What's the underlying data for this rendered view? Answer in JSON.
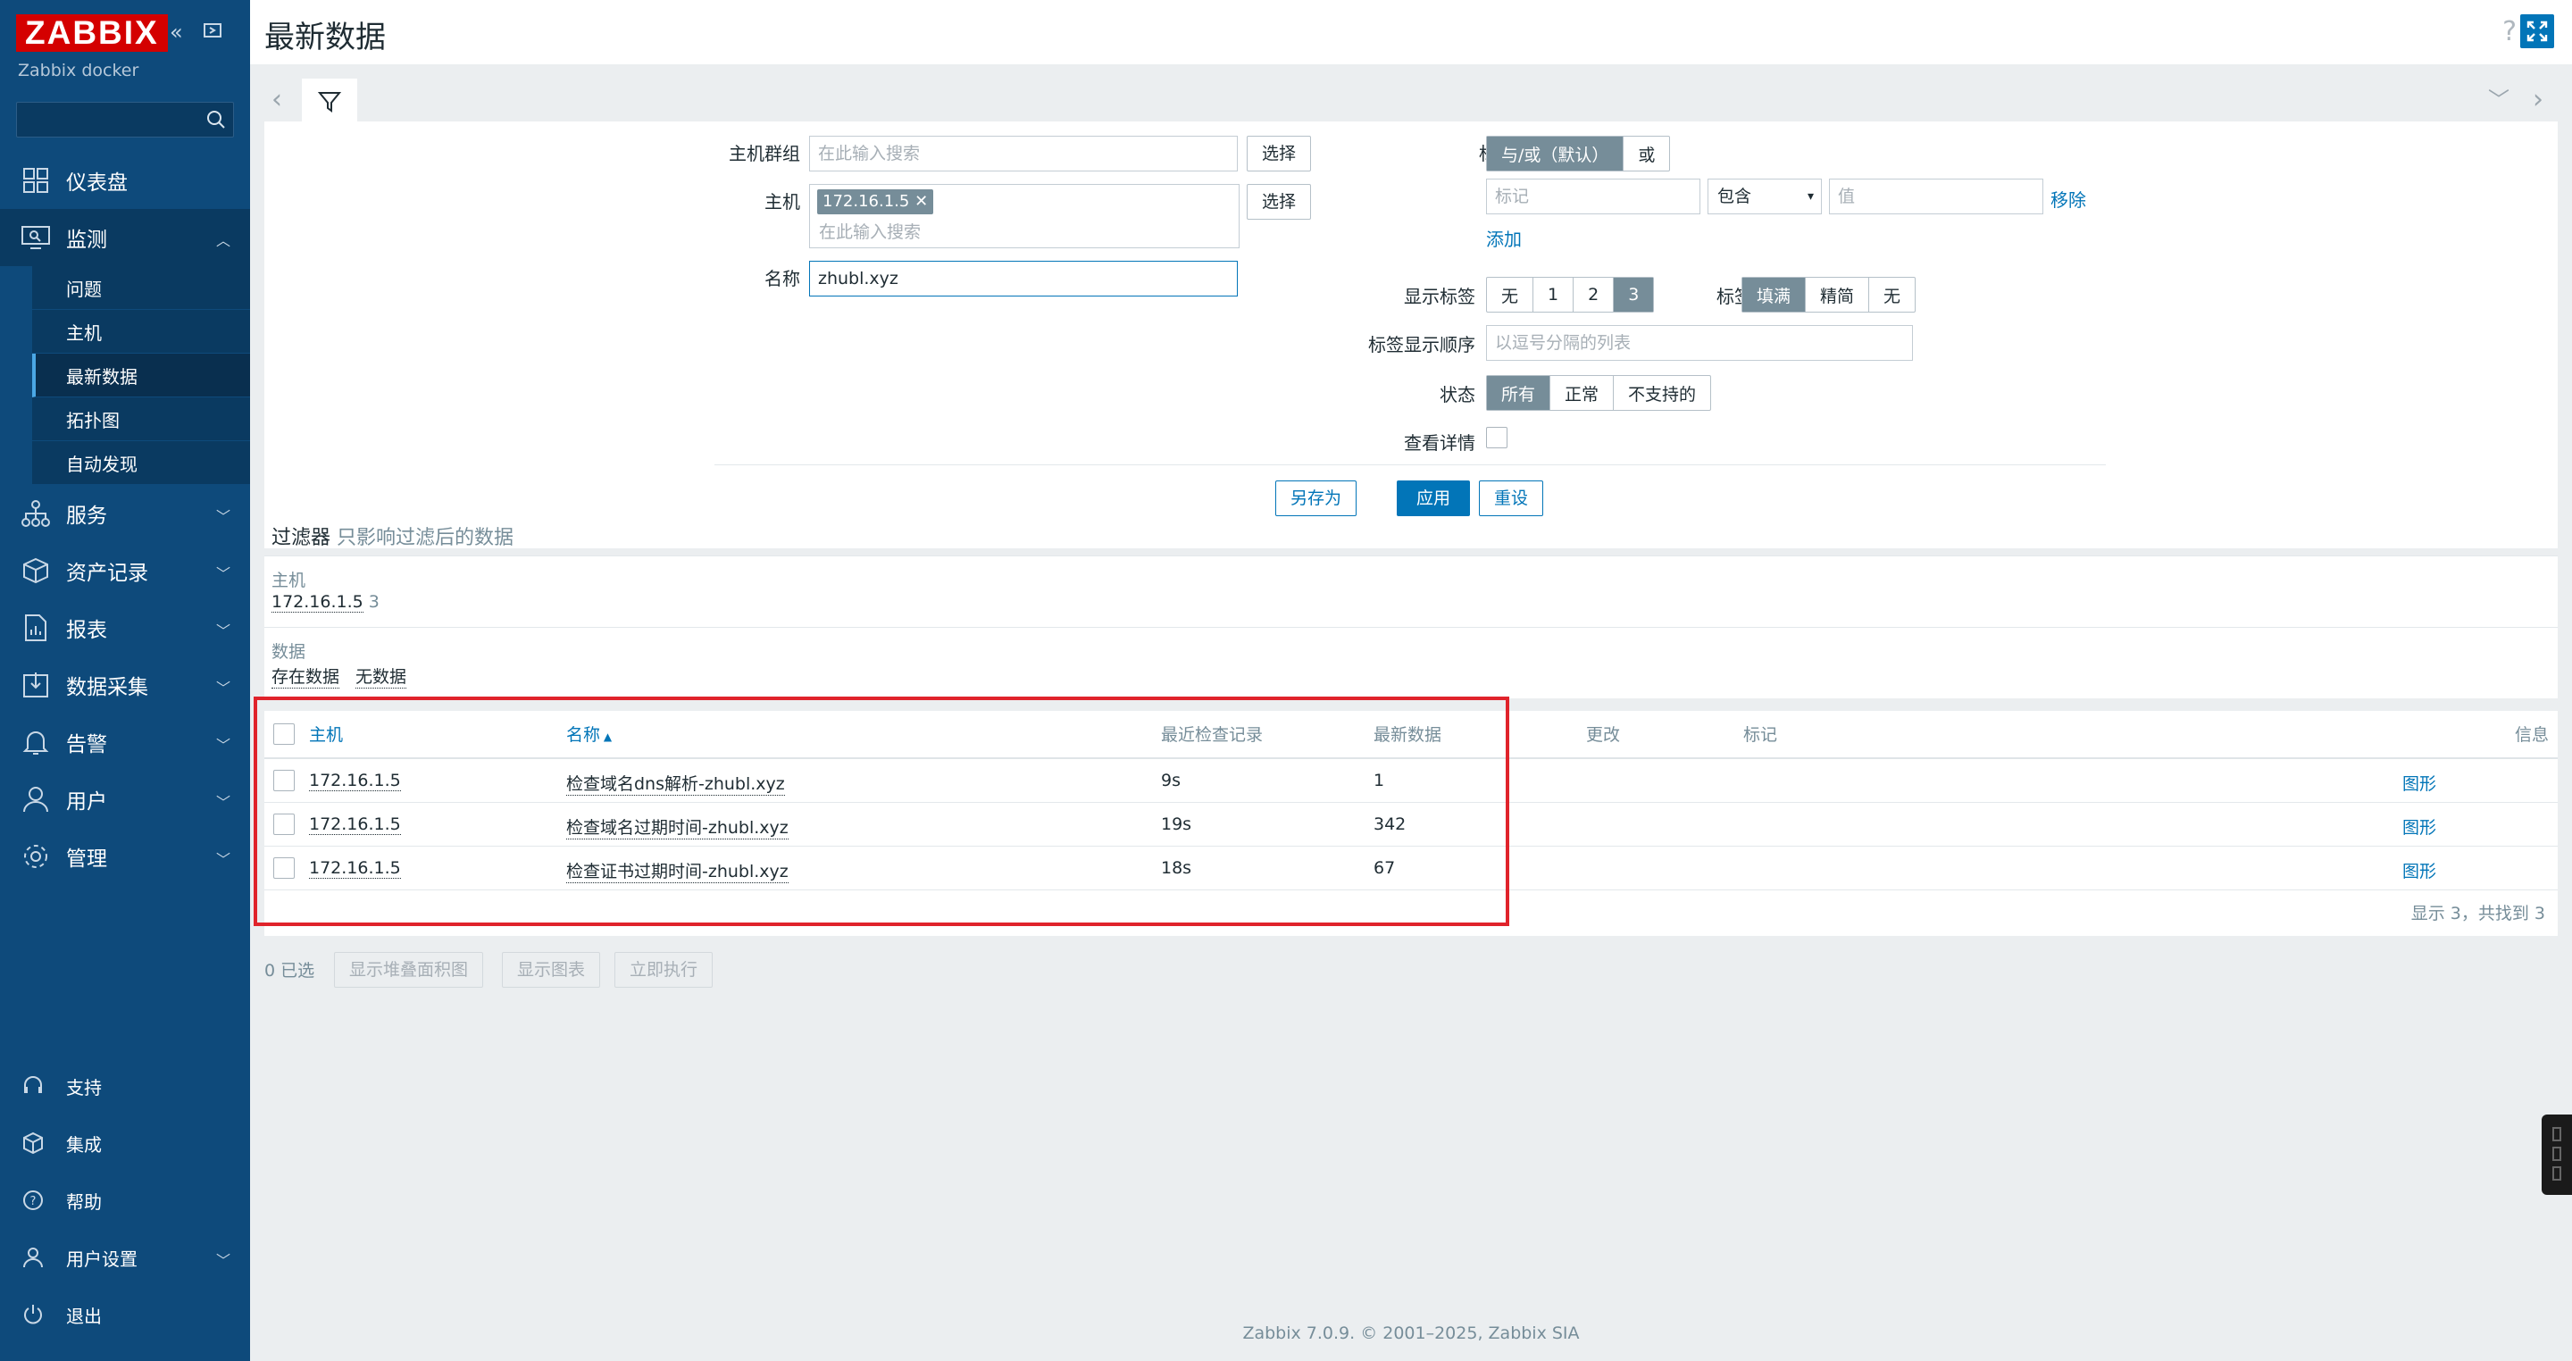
{
  "sidebar": {
    "logo": "ZABBIX",
    "server_name": "Zabbix docker",
    "menu": [
      {
        "label": "仪表盘",
        "icon": "dashboard-icon"
      },
      {
        "label": "监测",
        "icon": "monitoring-icon"
      },
      {
        "label": "服务",
        "icon": "services-icon"
      },
      {
        "label": "资产记录",
        "icon": "inventory-icon"
      },
      {
        "label": "报表",
        "icon": "reports-icon"
      },
      {
        "label": "数据采集",
        "icon": "data-collection-icon"
      },
      {
        "label": "告警",
        "icon": "alerts-icon"
      },
      {
        "label": "用户",
        "icon": "users-icon"
      },
      {
        "label": "管理",
        "icon": "administration-icon"
      }
    ],
    "submenu": [
      "问题",
      "主机",
      "最新数据",
      "拓扑图",
      "自动发现"
    ],
    "footer": [
      {
        "label": "支持",
        "icon": "support-icon"
      },
      {
        "label": "集成",
        "icon": "integrations-icon"
      },
      {
        "label": "帮助",
        "icon": "help-icon"
      },
      {
        "label": "用户设置",
        "icon": "user-settings-icon"
      },
      {
        "label": "退出",
        "icon": "sign-out-icon"
      }
    ]
  },
  "header": {
    "title": "最新数据"
  },
  "filter": {
    "host_groups_label": "主机群组",
    "host_groups_placeholder": "在此输入搜索",
    "select_label": "选择",
    "hosts_label": "主机",
    "host_chip": "172.16.1.5",
    "hosts_placeholder": "在此输入搜索",
    "name_label": "名称",
    "name_value": "zhubl.xyz",
    "tags_label": "标记",
    "tag_eval": [
      "与/或（默认）",
      "或"
    ],
    "tag_placeholder": "标记",
    "tag_operator": "包含",
    "value_placeholder": "值",
    "remove_label": "移除",
    "add_label": "添加",
    "show_tags_label": "显示标签",
    "show_tags_options": [
      "无",
      "1",
      "2",
      "3"
    ],
    "tag_name_label": "标签名",
    "tag_name_options": [
      "填满",
      "精简",
      "无"
    ],
    "tag_priority_label": "标签显示顺序",
    "tag_priority_placeholder": "以逗号分隔的列表",
    "state_label": "状态",
    "state_options": [
      "所有",
      "正常",
      "不支持的"
    ],
    "details_label": "查看详情",
    "save_as": "另存为",
    "apply": "应用",
    "reset": "重设"
  },
  "subfilter": {
    "title": "过滤器",
    "hint": "只影响过滤后的数据",
    "hosts_heading": "主机",
    "host_value": "172.16.1.5",
    "host_count": "3",
    "data_heading": "数据",
    "data_with": "存在数据",
    "data_without": "无数据"
  },
  "table": {
    "headers": {
      "host": "主机",
      "name": "名称",
      "last_check": "最近检查记录",
      "last_value": "最新数据",
      "change": "更改",
      "tags": "标记",
      "info": "信息"
    },
    "rows": [
      {
        "host": "172.16.1.5",
        "name": "检查域名dns解析-zhubl.xyz",
        "last_check": "9s",
        "last_value": "1",
        "action": "图形"
      },
      {
        "host": "172.16.1.5",
        "name": "检查域名过期时间-zhubl.xyz",
        "last_check": "19s",
        "last_value": "342",
        "action": "图形"
      },
      {
        "host": "172.16.1.5",
        "name": "检查证书过期时间-zhubl.xyz",
        "last_check": "18s",
        "last_value": "67",
        "action": "图形"
      }
    ],
    "footer": "显示 3，共找到 3"
  },
  "actions": {
    "selected": "0 已选",
    "stacked_graph": "显示堆叠面积图",
    "graph": "显示图表",
    "execute_now": "立即执行"
  },
  "footer": "Zabbix 7.0.9. © 2001–2025, Zabbix SIA",
  "colors": {
    "sidebar": "#0e4a7b",
    "accent": "#0275b8",
    "logo": "#d40000",
    "highlight_box": "#e0232b"
  }
}
